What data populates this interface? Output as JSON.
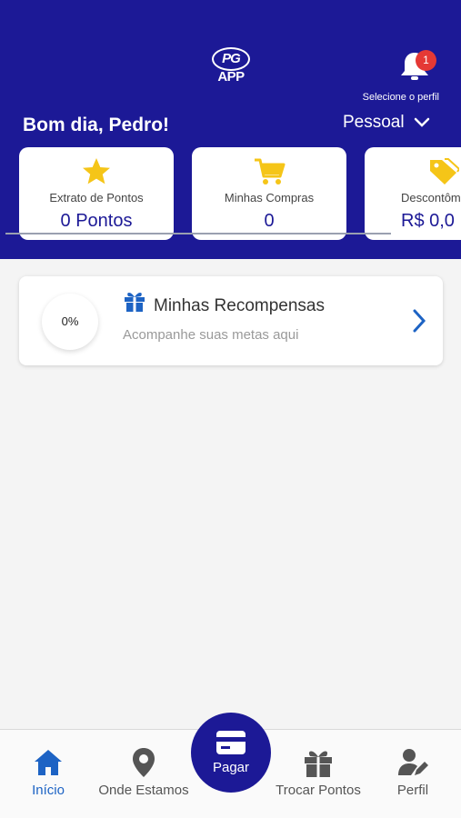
{
  "header": {
    "logo_top": "PG",
    "logo_bottom": "APP",
    "notification_count": "1",
    "select_profile": "Selecione o perfil",
    "greeting": "Bom dia, Pedro!",
    "profile": "Pessoal"
  },
  "cards": [
    {
      "label": "Extrato de Pontos",
      "value": "0 Pontos",
      "icon": "star-icon"
    },
    {
      "label": "Minhas Compras",
      "value": "0",
      "icon": "cart-icon"
    },
    {
      "label": "Descontôm",
      "value": "R$ 0,0",
      "icon": "tag-icon"
    }
  ],
  "rewards": {
    "progress": "0%",
    "title": "Minhas Recompensas",
    "subtitle": "Acompanhe suas metas aqui"
  },
  "tabs": [
    {
      "label": "Início",
      "icon": "home-icon",
      "active": true
    },
    {
      "label": "Onde Estamos",
      "icon": "location-pin-icon"
    },
    {
      "label": "Pagar",
      "icon": "card-icon"
    },
    {
      "label": "Trocar Pontos",
      "icon": "gift-icon"
    },
    {
      "label": "Perfil",
      "icon": "user-edit-icon"
    }
  ],
  "colors": {
    "primary": "#1c1996",
    "accent": "#1d63c4",
    "icon_yellow": "#f5c518",
    "badge": "#e53935"
  }
}
